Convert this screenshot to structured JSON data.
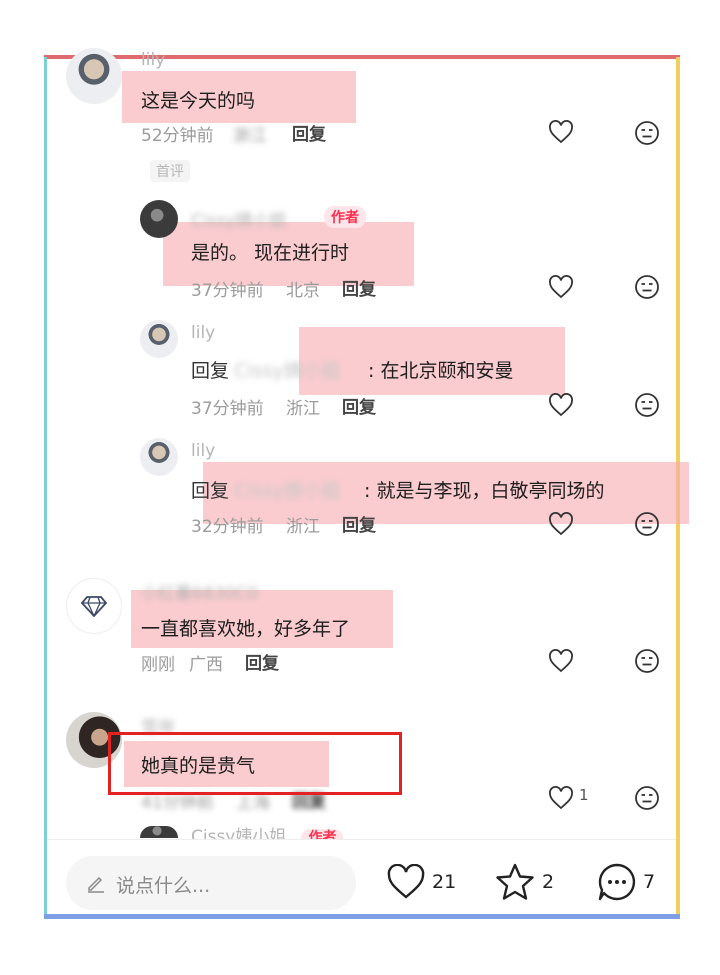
{
  "comments": [
    {
      "name": "lily",
      "text": "这是今天的吗",
      "time": "52分钟前",
      "location": "浙江",
      "reply_label": "回复",
      "first_comment_badge": "首评"
    },
    {
      "name": "Cissy姨小姐",
      "author_badge": "作者",
      "text": "是的。 现在进行时",
      "time": "37分钟前",
      "location": "北京",
      "reply_label": "回复"
    },
    {
      "name": "lily",
      "reply_prefix": "回复",
      "reply_target": "Cissy姨小姐",
      "text": ": 在北京颐和安曼",
      "time": "37分钟前",
      "location": "浙江",
      "reply_label": "回复"
    },
    {
      "name": "lily",
      "reply_prefix": "回复",
      "reply_target": "Cissy姨小姐",
      "text": ": 就是与李现，白敬亭同场的",
      "time": "32分钟前",
      "location": "浙江",
      "reply_label": "回复"
    },
    {
      "name": "小红薯6830C0",
      "text": "一直都喜欢她，好多年了",
      "time": "刚刚",
      "location": "广西",
      "reply_label": "回复"
    },
    {
      "name": "雪岸",
      "text": "她真的是贵气",
      "time": "41分钟前",
      "location": "上海",
      "reply_label": "回复",
      "like_count": "1"
    },
    {
      "name": "Cissy姨小姐",
      "author_badge": "作者"
    }
  ],
  "bottom_bar": {
    "input_placeholder": "说点什么...",
    "like_count": "21",
    "favorite_count": "2",
    "comment_count": "7"
  },
  "icons": {
    "like": "heart-outline-icon",
    "dislike": "unhappy-face-icon",
    "edit": "pencil-icon",
    "favorite": "star-outline-icon",
    "comment": "chat-bubble-icon",
    "verified": "diamond-icon"
  },
  "colors": {
    "highlight": "#f7aaaf",
    "annotation_box": "#e32222",
    "author_badge": "#ff2e4d",
    "frame_top": "#e06b6f",
    "frame_left": "#7ccfd6",
    "frame_right": "#f1cf5e",
    "frame_bottom": "#7e9ee6"
  }
}
